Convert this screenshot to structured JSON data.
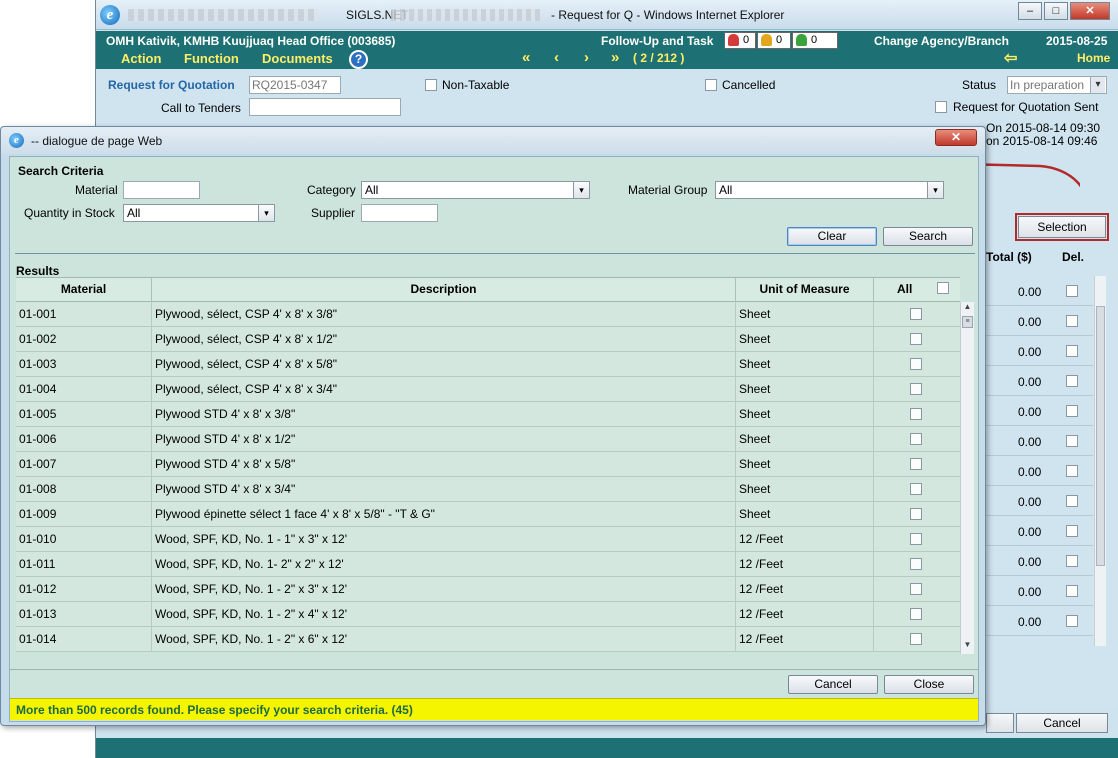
{
  "browser": {
    "app_name": "SIGLS.NET",
    "window_title": "- Request for Q - Windows Internet Explorer",
    "minimize_glyph": "–",
    "maximize_glyph": "□",
    "close_glyph": "✕",
    "logo_glyph": "e"
  },
  "header": {
    "org_name": "OMH Kativik, KMHB Kuujjuaq Head Office (003685)",
    "followup_label": "Follow-Up and Task",
    "task_counts": [
      "0",
      "0",
      "0"
    ],
    "task_colors": [
      "#d43a3a",
      "#e3a51e",
      "#3aa43a"
    ],
    "change_agency": "Change Agency/Branch",
    "date": "2015-08-25",
    "menus": {
      "action": "Action",
      "function": "Function",
      "documents": "Documents"
    },
    "help_glyph": "?",
    "nav": {
      "first": "«",
      "prev": "‹",
      "next": "›",
      "last": "»",
      "position": "( 2 / 212 )"
    },
    "home_arrow": "⇦",
    "home": "Home"
  },
  "form": {
    "rfq_label": "Request for Quotation",
    "rfq_number": "RQ2015-0347",
    "non_taxable": "Non-Taxable",
    "cancelled": "Cancelled",
    "status_label": "Status",
    "status_value": "In preparation",
    "call_to_tenders": "Call to Tenders",
    "rfq_sent": "Request for Quotation Sent",
    "created_on": "On 2015-08-14 09:30",
    "modified_on": "on 2015-08-14 09:46",
    "selection_button": "Selection",
    "total_header": "Total ($)",
    "del_header": "Del.",
    "line_amounts": [
      "0.00",
      "0.00",
      "0.00",
      "0.00",
      "0.00",
      "0.00",
      "0.00",
      "0.00",
      "0.00",
      "0.00",
      "0.00",
      "0.00"
    ],
    "cancel_button": "Cancel"
  },
  "dialog": {
    "title": "-- dialogue de page Web",
    "close_glyph": "✕",
    "logo_glyph": "e",
    "criteria": {
      "title": "Search Criteria",
      "material_label": "Material",
      "material_value": "",
      "category_label": "Category",
      "category_value": "All",
      "material_group_label": "Material Group",
      "material_group_value": "All",
      "quantity_label": "Quantity in Stock",
      "quantity_value": "All",
      "supplier_label": "Supplier",
      "supplier_value": "",
      "clear_button": "Clear",
      "search_button": "Search",
      "dropdown_glyph": "▾"
    },
    "results": {
      "title": "Results",
      "columns": {
        "material": "Material",
        "description": "Description",
        "uom": "Unit of Measure",
        "all": "All"
      },
      "rows": [
        {
          "material": "01-001",
          "description": "Plywood, sélect, CSP 4' x 8' x 3/8\"",
          "uom": "Sheet"
        },
        {
          "material": "01-002",
          "description": "Plywood, sélect, CSP 4' x 8' x 1/2\"",
          "uom": "Sheet"
        },
        {
          "material": "01-003",
          "description": "Plywood, sélect, CSP 4' x 8' x 5/8\"",
          "uom": "Sheet"
        },
        {
          "material": "01-004",
          "description": "Plywood, sélect, CSP 4' x 8' x 3/4\"",
          "uom": "Sheet"
        },
        {
          "material": "01-005",
          "description": "Plywood STD 4' x 8' x 3/8\"",
          "uom": "Sheet"
        },
        {
          "material": "01-006",
          "description": "Plywood STD 4' x 8' x 1/2\"",
          "uom": "Sheet"
        },
        {
          "material": "01-007",
          "description": "Plywood STD 4' x 8' x 5/8\"",
          "uom": "Sheet"
        },
        {
          "material": "01-008",
          "description": "Plywood STD 4' x 8' x 3/4\"",
          "uom": "Sheet"
        },
        {
          "material": "01-009",
          "description": "Plywood épinette sélect 1 face 4' x 8' x 5/8\" - \"T & G\"",
          "uom": "Sheet"
        },
        {
          "material": "01-010",
          "description": "Wood, SPF, KD, No. 1 - 1\" x 3\" x 12'",
          "uom": "12 /Feet"
        },
        {
          "material": "01-011",
          "description": "Wood, SPF, KD, No. 1- 2\" x 2\" x 12'",
          "uom": "12 /Feet"
        },
        {
          "material": "01-012",
          "description": "Wood, SPF, KD, No. 1 - 2\" x 3\" x 12'",
          "uom": "12 /Feet"
        },
        {
          "material": "01-013",
          "description": "Wood, SPF, KD, No. 1 - 2\" x 4\" x 12'",
          "uom": "12 /Feet"
        },
        {
          "material": "01-014",
          "description": "Wood, SPF, KD, No. 1 - 2\" x 6\" x 12'",
          "uom": "12 /Feet"
        }
      ]
    },
    "scroll_up_glyph": "▲",
    "scroll_down_glyph": "▼",
    "scroll_thumb_glyph": "≡",
    "cancel_button": "Cancel",
    "close_button": "Close",
    "message": "More than 500 records found. Please specify your search criteria. (45)"
  },
  "colors": {
    "header_teal": "#1d7073",
    "menu_yellow": "#ffee66",
    "message_yellow": "#f5f500",
    "message_text": "#1d6b42",
    "annotation_red": "#b22a2a"
  }
}
